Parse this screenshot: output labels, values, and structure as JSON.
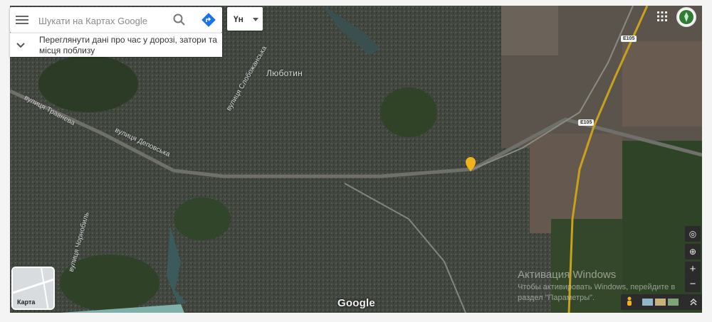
{
  "search": {
    "placeholder": "Шукати на Картах Google"
  },
  "suggestion": {
    "text": "Переглянути дані про час у дорозі, затори та місця поблизу"
  },
  "language": {
    "label": "Үн"
  },
  "map": {
    "town_label": "Люботин",
    "street_labels": [
      "вулиця Травнева",
      "вулиця Деповська",
      "вулиця Слобожанська",
      "вулиця Чорнобиль"
    ],
    "highway_shields": [
      "E105",
      "E105"
    ],
    "minimap_label": "Карта",
    "logo": "Google"
  },
  "activation": {
    "title": "Активация Windows",
    "text": "Чтобы активировать Windows, перейдите в раздел \"Параметры\"."
  },
  "colors": {
    "accent_blue": "#1a73e8",
    "marker": "#f2b21b",
    "highway": "#c8a21a"
  }
}
